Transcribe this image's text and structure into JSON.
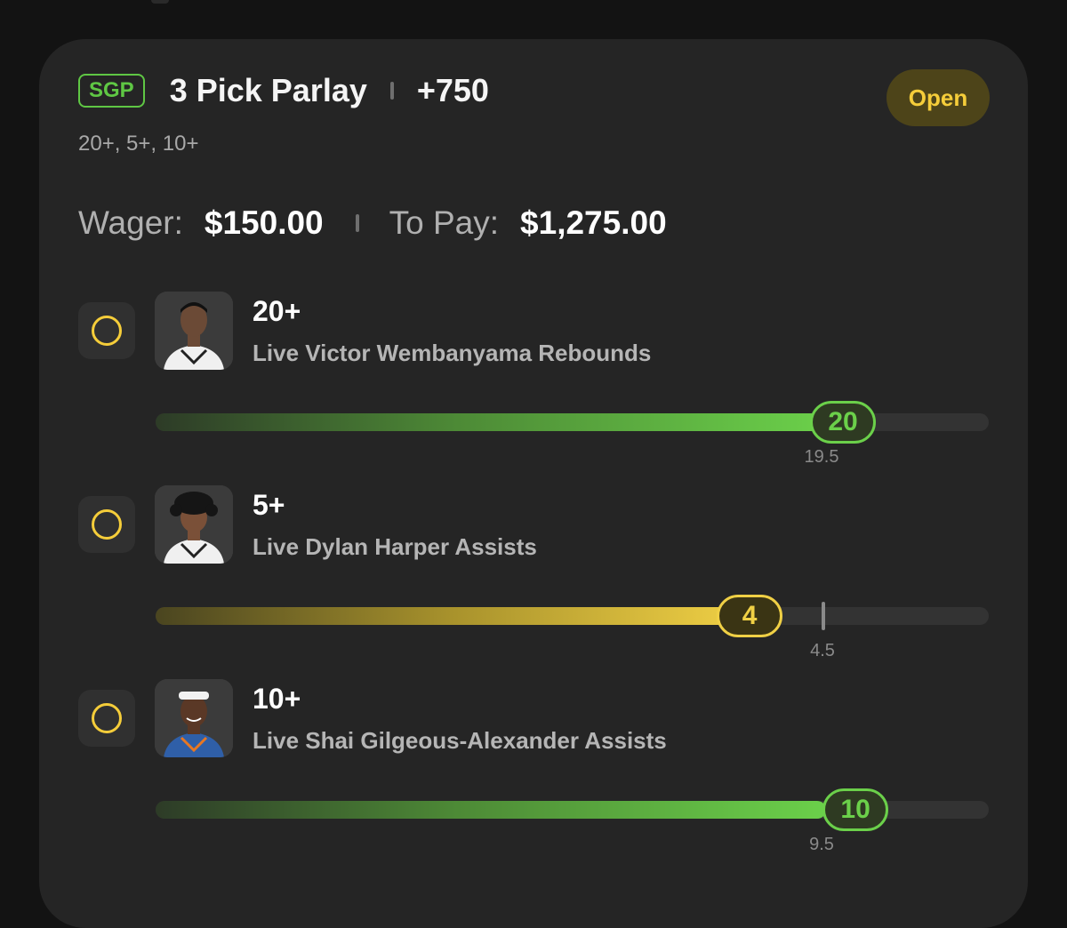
{
  "colors": {
    "accent_green": "#6bd04a",
    "accent_yellow": "#f0d045",
    "card_bg": "#252525",
    "page_bg": "#131313"
  },
  "bet": {
    "badge": "SGP",
    "title": "3 Pick Parlay",
    "odds": "+750",
    "status": "Open",
    "summary": "20+, 5+, 10+",
    "wager_label": "Wager:",
    "wager_value": "$150.00",
    "payout_label": "To Pay:",
    "payout_value": "$1,275.00"
  },
  "legs": [
    {
      "threshold": "20+",
      "market": "Live Victor Wembanyama Rebounds",
      "current": 20,
      "current_label": "20",
      "line": 19.5,
      "line_label": "19.5",
      "progress_pct": 80.5,
      "line_pct": 80.2,
      "state": "green",
      "icon": "player-headshot-icon"
    },
    {
      "threshold": "5+",
      "market": "Live Dylan Harper Assists",
      "current": 4,
      "current_label": "4",
      "line": 4.5,
      "line_label": "4.5",
      "progress_pct": 71,
      "line_pct": 80.2,
      "state": "yellow",
      "icon": "player-headshot-icon"
    },
    {
      "threshold": "10+",
      "market": "Live Shai Gilgeous-Alexander Assists",
      "current": 10,
      "current_label": "10",
      "line": 9.5,
      "line_label": "9.5",
      "progress_pct": 80.5,
      "line_pct": 80.2,
      "state": "green",
      "icon": "player-headshot-icon"
    }
  ]
}
